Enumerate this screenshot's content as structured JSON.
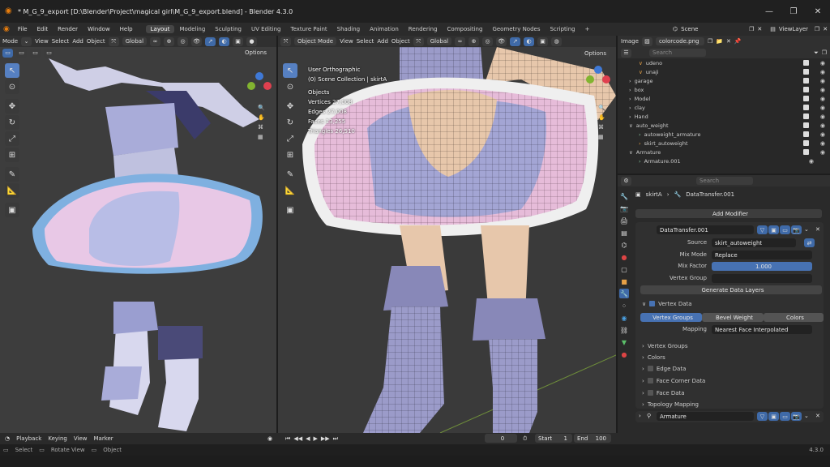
{
  "window": {
    "title": "* M_G_9_export [D:\\Blender\\Project\\magical girl\\M_G_9_export.blend] - Blender 4.3.0",
    "minimize": "—",
    "maximize": "❐",
    "close": "✕"
  },
  "menu": [
    "File",
    "Edit",
    "Render",
    "Window",
    "Help"
  ],
  "workspaces": [
    "Layout",
    "Modeling",
    "Sculpting",
    "UV Editing",
    "Texture Paint",
    "Shading",
    "Animation",
    "Rendering",
    "Compositing",
    "Geometry Nodes",
    "Scripting"
  ],
  "scene": {
    "scene_label": "Scene",
    "viewlayer_label": "ViewLayer"
  },
  "vp1": {
    "mode": "Mode",
    "menus": [
      "View",
      "Select",
      "Add",
      "Object"
    ],
    "orientation": "Global",
    "options": "Options"
  },
  "vp2": {
    "mode": "Object Mode",
    "menus": [
      "View",
      "Select",
      "Add",
      "Object"
    ],
    "orientation": "Global",
    "options": "Options",
    "overlay_lines": [
      "User Orthographic",
      "(0) Scene Collection | skirtA",
      "Objects",
      "Vertices  27,008",
      "Edges  27,008",
      "Faces  13,255",
      "Triangles  26,510"
    ]
  },
  "image_editor": {
    "label": "Image",
    "file": "colorcode.png"
  },
  "outliner": {
    "search_placeholder": "Search",
    "items": [
      "udeno",
      "unaji",
      "garage",
      "box",
      "Model",
      "clay",
      "Hand",
      "auto_weight",
      "autoweight_armature",
      "skirt_autoweight",
      "Armature",
      "Armature.001"
    ]
  },
  "properties": {
    "search_placeholder": "Search",
    "breadcrumb_obj": "skirtA",
    "breadcrumb_mod": "DataTransfer.001",
    "add_modifier": "Add Modifier",
    "modifier_name": "DataTransfer.001",
    "source_label": "Source",
    "source_value": "skirt_autoweight",
    "mix_mode_label": "Mix Mode",
    "mix_mode_value": "Replace",
    "mix_factor_label": "Mix Factor",
    "mix_factor_value": "1.000",
    "vgroup_label": "Vertex Group",
    "generate": "Generate Data Layers",
    "vertex_data": "Vertex Data",
    "tabs": [
      "Vertex Groups",
      "Bevel Weight",
      "Colors"
    ],
    "mapping_label": "Mapping",
    "mapping_value": "Nearest Face Interpolated",
    "sub_panels": [
      "Vertex Groups",
      "Colors",
      "Edge Data",
      "Face Corner Data",
      "Face Data",
      "Topology Mapping"
    ],
    "armature_mod": "Armature"
  },
  "timeline": {
    "playback": "Playback",
    "keying": "Keying",
    "view": "View",
    "marker": "Marker",
    "frame": "0",
    "start_label": "Start",
    "start": "1",
    "end_label": "End",
    "end": "100"
  },
  "status": {
    "select": "Select",
    "rotate": "Rotate View",
    "object": "Object",
    "version": "4.3.0"
  }
}
